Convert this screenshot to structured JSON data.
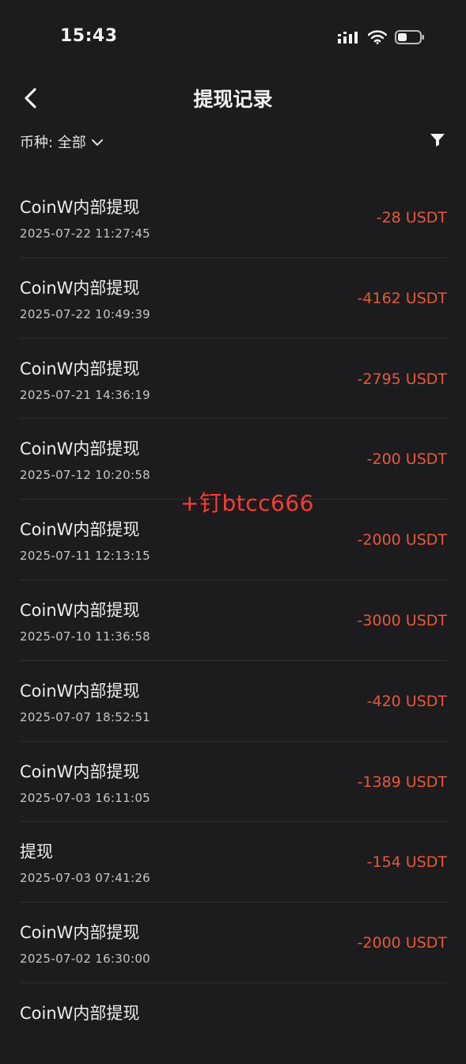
{
  "status_bar": {
    "time": "15:43"
  },
  "nav": {
    "title": "提现记录"
  },
  "filter": {
    "currency_label": "币种: 全部"
  },
  "watermark": "+钉btcc666",
  "records": [
    {
      "title": "CoinW内部提现",
      "time": "2025-07-22 11:27:45",
      "amount": "-28 USDT"
    },
    {
      "title": "CoinW内部提现",
      "time": "2025-07-22 10:49:39",
      "amount": "-4162 USDT"
    },
    {
      "title": "CoinW内部提现",
      "time": "2025-07-21 14:36:19",
      "amount": "-2795 USDT"
    },
    {
      "title": "CoinW内部提现",
      "time": "2025-07-12 10:20:58",
      "amount": "-200 USDT"
    },
    {
      "title": "CoinW内部提现",
      "time": "2025-07-11 12:13:15",
      "amount": "-2000 USDT"
    },
    {
      "title": "CoinW内部提现",
      "time": "2025-07-10 11:36:58",
      "amount": "-3000 USDT"
    },
    {
      "title": "CoinW内部提现",
      "time": "2025-07-07 18:52:51",
      "amount": "-420 USDT"
    },
    {
      "title": "CoinW内部提现",
      "time": "2025-07-03 16:11:05",
      "amount": "-1389 USDT"
    },
    {
      "title": "提现",
      "time": "2025-07-03 07:41:26",
      "amount": "-154 USDT"
    },
    {
      "title": "CoinW内部提现",
      "time": "2025-07-02 16:30:00",
      "amount": "-2000 USDT"
    },
    {
      "title": "CoinW内部提现",
      "time": "",
      "amount": ""
    }
  ],
  "colors": {
    "background": "#1c1c1e",
    "amount": "#e5593a",
    "watermark": "#ff3b2f"
  }
}
